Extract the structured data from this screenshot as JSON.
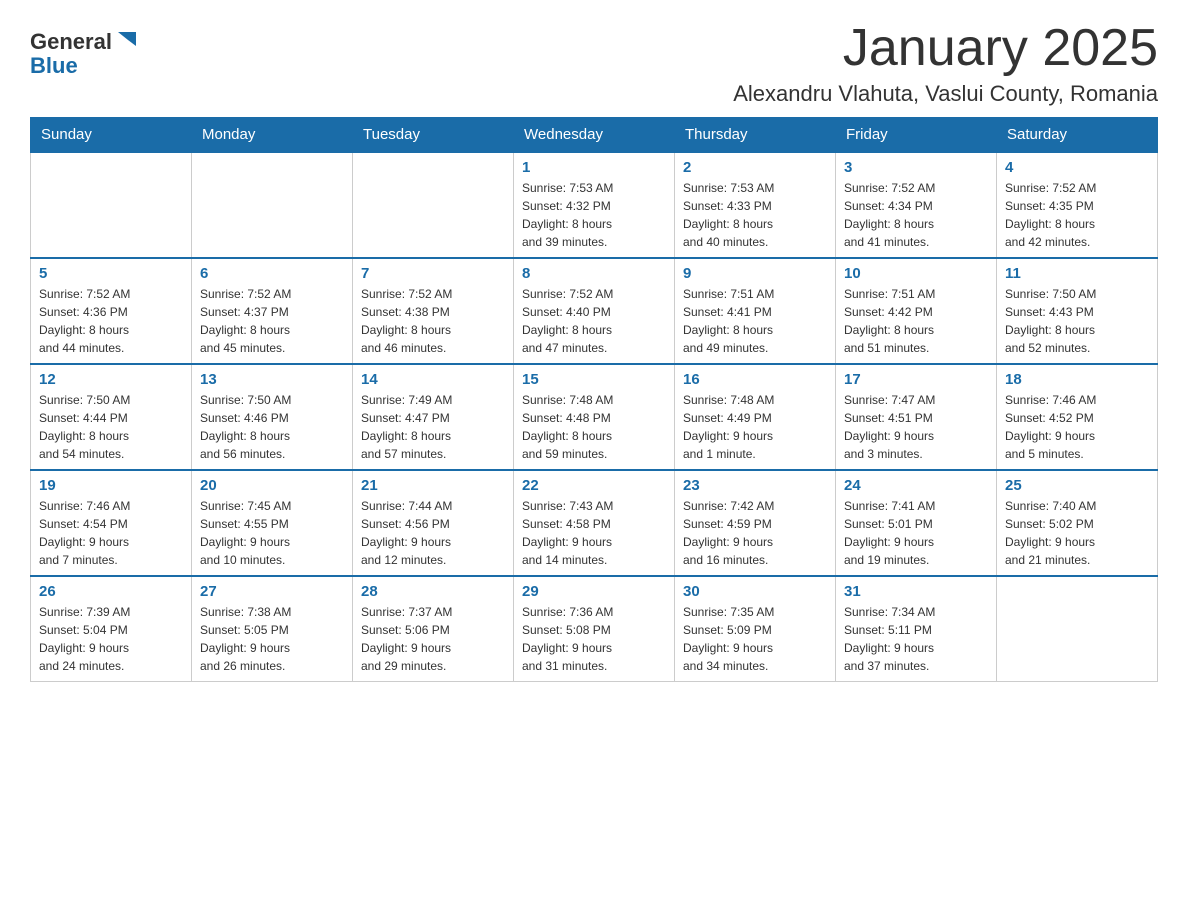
{
  "header": {
    "logo": {
      "general": "General",
      "blue": "Blue",
      "arrow_color": "#1a6ca8"
    },
    "title": "January 2025",
    "location": "Alexandru Vlahuta, Vaslui County, Romania"
  },
  "days_of_week": [
    "Sunday",
    "Monday",
    "Tuesday",
    "Wednesday",
    "Thursday",
    "Friday",
    "Saturday"
  ],
  "weeks": [
    {
      "cells": [
        {
          "day": "",
          "info": ""
        },
        {
          "day": "",
          "info": ""
        },
        {
          "day": "",
          "info": ""
        },
        {
          "day": "1",
          "info": "Sunrise: 7:53 AM\nSunset: 4:32 PM\nDaylight: 8 hours\nand 39 minutes."
        },
        {
          "day": "2",
          "info": "Sunrise: 7:53 AM\nSunset: 4:33 PM\nDaylight: 8 hours\nand 40 minutes."
        },
        {
          "day": "3",
          "info": "Sunrise: 7:52 AM\nSunset: 4:34 PM\nDaylight: 8 hours\nand 41 minutes."
        },
        {
          "day": "4",
          "info": "Sunrise: 7:52 AM\nSunset: 4:35 PM\nDaylight: 8 hours\nand 42 minutes."
        }
      ]
    },
    {
      "cells": [
        {
          "day": "5",
          "info": "Sunrise: 7:52 AM\nSunset: 4:36 PM\nDaylight: 8 hours\nand 44 minutes."
        },
        {
          "day": "6",
          "info": "Sunrise: 7:52 AM\nSunset: 4:37 PM\nDaylight: 8 hours\nand 45 minutes."
        },
        {
          "day": "7",
          "info": "Sunrise: 7:52 AM\nSunset: 4:38 PM\nDaylight: 8 hours\nand 46 minutes."
        },
        {
          "day": "8",
          "info": "Sunrise: 7:52 AM\nSunset: 4:40 PM\nDaylight: 8 hours\nand 47 minutes."
        },
        {
          "day": "9",
          "info": "Sunrise: 7:51 AM\nSunset: 4:41 PM\nDaylight: 8 hours\nand 49 minutes."
        },
        {
          "day": "10",
          "info": "Sunrise: 7:51 AM\nSunset: 4:42 PM\nDaylight: 8 hours\nand 51 minutes."
        },
        {
          "day": "11",
          "info": "Sunrise: 7:50 AM\nSunset: 4:43 PM\nDaylight: 8 hours\nand 52 minutes."
        }
      ]
    },
    {
      "cells": [
        {
          "day": "12",
          "info": "Sunrise: 7:50 AM\nSunset: 4:44 PM\nDaylight: 8 hours\nand 54 minutes."
        },
        {
          "day": "13",
          "info": "Sunrise: 7:50 AM\nSunset: 4:46 PM\nDaylight: 8 hours\nand 56 minutes."
        },
        {
          "day": "14",
          "info": "Sunrise: 7:49 AM\nSunset: 4:47 PM\nDaylight: 8 hours\nand 57 minutes."
        },
        {
          "day": "15",
          "info": "Sunrise: 7:48 AM\nSunset: 4:48 PM\nDaylight: 8 hours\nand 59 minutes."
        },
        {
          "day": "16",
          "info": "Sunrise: 7:48 AM\nSunset: 4:49 PM\nDaylight: 9 hours\nand 1 minute."
        },
        {
          "day": "17",
          "info": "Sunrise: 7:47 AM\nSunset: 4:51 PM\nDaylight: 9 hours\nand 3 minutes."
        },
        {
          "day": "18",
          "info": "Sunrise: 7:46 AM\nSunset: 4:52 PM\nDaylight: 9 hours\nand 5 minutes."
        }
      ]
    },
    {
      "cells": [
        {
          "day": "19",
          "info": "Sunrise: 7:46 AM\nSunset: 4:54 PM\nDaylight: 9 hours\nand 7 minutes."
        },
        {
          "day": "20",
          "info": "Sunrise: 7:45 AM\nSunset: 4:55 PM\nDaylight: 9 hours\nand 10 minutes."
        },
        {
          "day": "21",
          "info": "Sunrise: 7:44 AM\nSunset: 4:56 PM\nDaylight: 9 hours\nand 12 minutes."
        },
        {
          "day": "22",
          "info": "Sunrise: 7:43 AM\nSunset: 4:58 PM\nDaylight: 9 hours\nand 14 minutes."
        },
        {
          "day": "23",
          "info": "Sunrise: 7:42 AM\nSunset: 4:59 PM\nDaylight: 9 hours\nand 16 minutes."
        },
        {
          "day": "24",
          "info": "Sunrise: 7:41 AM\nSunset: 5:01 PM\nDaylight: 9 hours\nand 19 minutes."
        },
        {
          "day": "25",
          "info": "Sunrise: 7:40 AM\nSunset: 5:02 PM\nDaylight: 9 hours\nand 21 minutes."
        }
      ]
    },
    {
      "cells": [
        {
          "day": "26",
          "info": "Sunrise: 7:39 AM\nSunset: 5:04 PM\nDaylight: 9 hours\nand 24 minutes."
        },
        {
          "day": "27",
          "info": "Sunrise: 7:38 AM\nSunset: 5:05 PM\nDaylight: 9 hours\nand 26 minutes."
        },
        {
          "day": "28",
          "info": "Sunrise: 7:37 AM\nSunset: 5:06 PM\nDaylight: 9 hours\nand 29 minutes."
        },
        {
          "day": "29",
          "info": "Sunrise: 7:36 AM\nSunset: 5:08 PM\nDaylight: 9 hours\nand 31 minutes."
        },
        {
          "day": "30",
          "info": "Sunrise: 7:35 AM\nSunset: 5:09 PM\nDaylight: 9 hours\nand 34 minutes."
        },
        {
          "day": "31",
          "info": "Sunrise: 7:34 AM\nSunset: 5:11 PM\nDaylight: 9 hours\nand 37 minutes."
        },
        {
          "day": "",
          "info": ""
        }
      ]
    }
  ]
}
